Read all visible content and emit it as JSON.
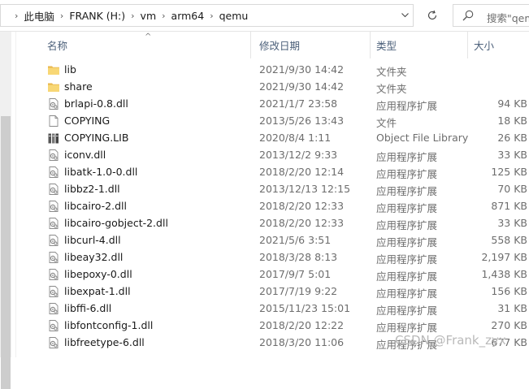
{
  "address": {
    "crumbs": [
      "此电脑",
      "FRANK (H:)",
      "vm",
      "arm64",
      "qemu"
    ]
  },
  "search": {
    "placeholder": "搜索\"qemu\""
  },
  "columns": {
    "name": "名称",
    "date": "修改日期",
    "type": "类型",
    "size": "大小"
  },
  "files": [
    {
      "name": "lib",
      "date": "2021/9/30 14:42",
      "type": "文件夹",
      "size": "",
      "icon": "folder-icon"
    },
    {
      "name": "share",
      "date": "2021/9/30 14:42",
      "type": "文件夹",
      "size": "",
      "icon": "folder-icon"
    },
    {
      "name": "brlapi-0.8.dll",
      "date": "2021/1/7 23:58",
      "type": "应用程序扩展",
      "size": "94 KB",
      "icon": "dll-icon"
    },
    {
      "name": "COPYING",
      "date": "2013/5/26 13:43",
      "type": "文件",
      "size": "18 KB",
      "icon": "file-icon"
    },
    {
      "name": "COPYING.LIB",
      "date": "2020/8/4 1:11",
      "type": "Object File Library",
      "size": "26 KB",
      "icon": "lib-icon"
    },
    {
      "name": "iconv.dll",
      "date": "2013/12/2 9:33",
      "type": "应用程序扩展",
      "size": "33 KB",
      "icon": "dll-icon"
    },
    {
      "name": "libatk-1.0-0.dll",
      "date": "2018/2/20 12:14",
      "type": "应用程序扩展",
      "size": "125 KB",
      "icon": "dll-icon"
    },
    {
      "name": "libbz2-1.dll",
      "date": "2013/12/13 12:15",
      "type": "应用程序扩展",
      "size": "70 KB",
      "icon": "dll-icon"
    },
    {
      "name": "libcairo-2.dll",
      "date": "2018/2/20 12:33",
      "type": "应用程序扩展",
      "size": "871 KB",
      "icon": "dll-icon"
    },
    {
      "name": "libcairo-gobject-2.dll",
      "date": "2018/2/20 12:33",
      "type": "应用程序扩展",
      "size": "33 KB",
      "icon": "dll-icon"
    },
    {
      "name": "libcurl-4.dll",
      "date": "2021/5/6 3:51",
      "type": "应用程序扩展",
      "size": "558 KB",
      "icon": "dll-icon"
    },
    {
      "name": "libeay32.dll",
      "date": "2018/3/28 8:13",
      "type": "应用程序扩展",
      "size": "2,197 KB",
      "icon": "dll-icon"
    },
    {
      "name": "libepoxy-0.dll",
      "date": "2017/9/7 5:01",
      "type": "应用程序扩展",
      "size": "1,438 KB",
      "icon": "dll-icon"
    },
    {
      "name": "libexpat-1.dll",
      "date": "2017/7/19 9:22",
      "type": "应用程序扩展",
      "size": "156 KB",
      "icon": "dll-icon"
    },
    {
      "name": "libffi-6.dll",
      "date": "2015/11/23 15:01",
      "type": "应用程序扩展",
      "size": "31 KB",
      "icon": "dll-icon"
    },
    {
      "name": "libfontconfig-1.dll",
      "date": "2018/2/20 12:22",
      "type": "应用程序扩展",
      "size": "270 KB",
      "icon": "dll-icon"
    },
    {
      "name": "libfreetype-6.dll",
      "date": "2018/3/20 11:06",
      "type": "应用程序扩展",
      "size": "677 KB",
      "icon": "dll-icon"
    }
  ],
  "watermark": "CSDN @Frank_zyx"
}
